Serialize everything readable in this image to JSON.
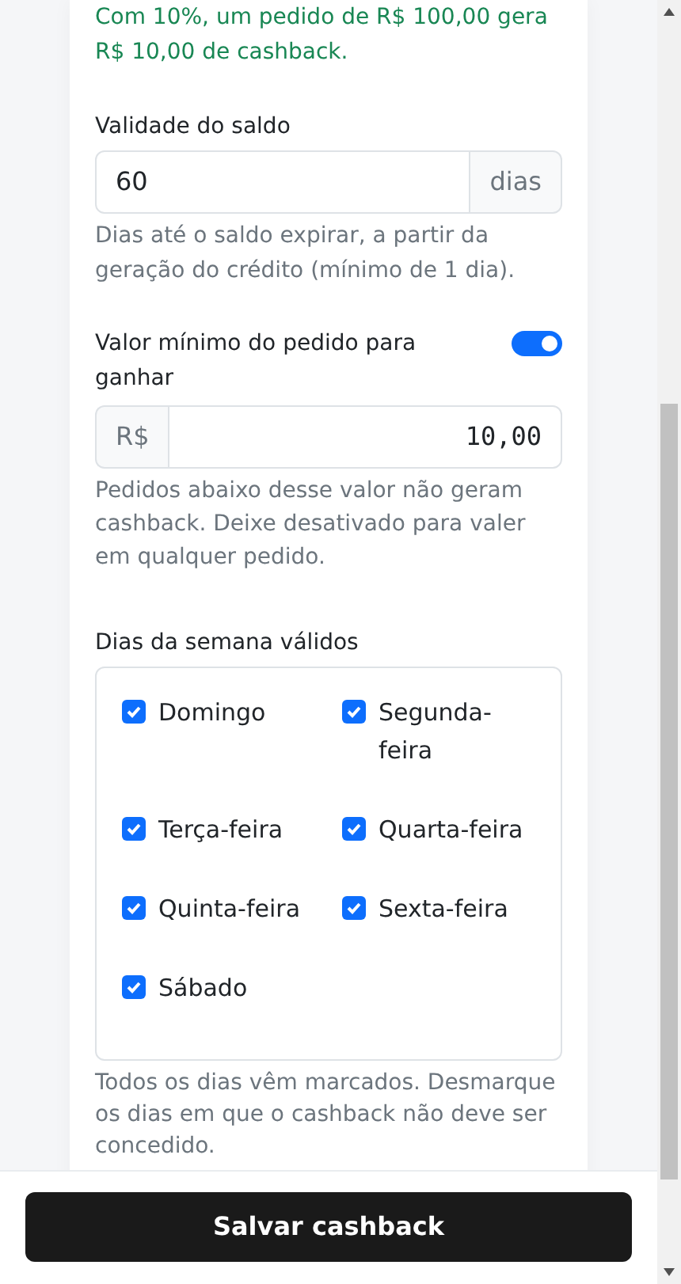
{
  "example_note": "Com 10%, um pedido de R$ 100,00 gera R$ 10,00 de cashback.",
  "validity": {
    "label": "Validade do saldo",
    "value": "60",
    "suffix": "dias",
    "hint": "Dias até o saldo expirar, a partir da geração do crédito (mínimo de 1 dia)."
  },
  "min_order": {
    "label": "Valor mínimo do pedido para ganhar",
    "on": true,
    "prefix": "R$",
    "value": "10,00",
    "hint": "Pedidos abaixo desse valor não geram cashback. Deixe desativado para valer em qualquer pedido."
  },
  "weekdays": {
    "label": "Dias da semana válidos",
    "days": [
      {
        "label": "Domingo",
        "checked": true
      },
      {
        "label": "Segunda-feira",
        "checked": true
      },
      {
        "label": "Terça-feira",
        "checked": true
      },
      {
        "label": "Quarta-feira",
        "checked": true
      },
      {
        "label": "Quinta-feira",
        "checked": true
      },
      {
        "label": "Sexta-feira",
        "checked": true
      },
      {
        "label": "Sábado",
        "checked": true
      }
    ],
    "hint": "Todos os dias vêm marcados. Desmarque os dias em que o cashback não deve ser concedido."
  },
  "save_button": "Salvar cashback"
}
